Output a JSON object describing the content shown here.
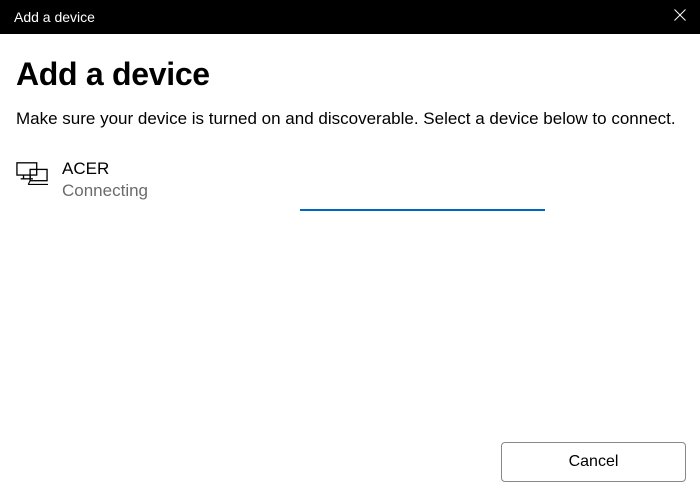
{
  "titlebar": {
    "title": "Add a device"
  },
  "heading": "Add a device",
  "subtitle": "Make sure your device is turned on and discoverable. Select a device below to connect.",
  "device": {
    "name": "ACER",
    "status": "Connecting"
  },
  "footer": {
    "cancel_label": "Cancel"
  },
  "colors": {
    "accent": "#0067c0"
  }
}
